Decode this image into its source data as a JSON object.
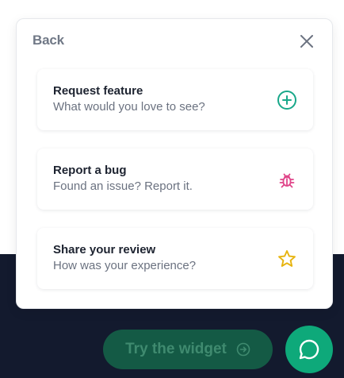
{
  "panel": {
    "back_label": "Back",
    "close_icon": "close-icon"
  },
  "options": [
    {
      "title": "Request feature",
      "subtitle": "What would you love to see?",
      "icon": "plus-circle-icon",
      "icon_color": "#19a88a"
    },
    {
      "title": "Report a bug",
      "subtitle": "Found an issue? Report it.",
      "icon": "bug-icon",
      "icon_color": "#e0468a"
    },
    {
      "title": "Share your review",
      "subtitle": "How was your experience?",
      "icon": "star-icon",
      "icon_color": "#e7b40f"
    }
  ],
  "footer": {
    "try_label": "Try the widget",
    "try_icon": "arrow-right-circle-icon",
    "chat_icon": "chat-bubble-icon"
  },
  "colors": {
    "dark_background": "#131a2e",
    "accent_green": "#0ea97a",
    "button_green": "#145a45"
  }
}
